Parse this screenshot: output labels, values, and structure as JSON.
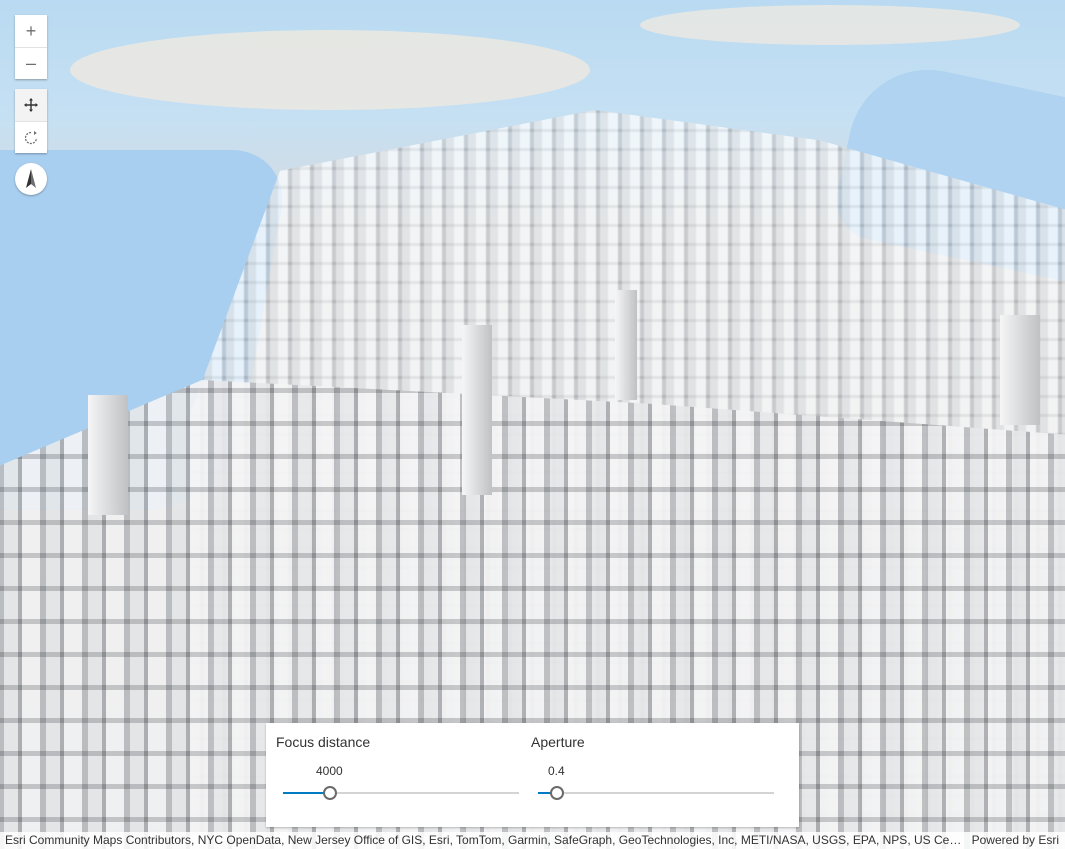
{
  "zoom": {
    "in_symbol": "+",
    "out_symbol": "–"
  },
  "navigation": {
    "pan_icon": "pan-arrows-icon",
    "rotate_icon": "rotate-icon"
  },
  "compass": {
    "icon": "compass-needle-icon"
  },
  "focus_distance": {
    "label": "Focus distance",
    "value": "4000",
    "fraction": 0.2
  },
  "aperture": {
    "label": "Aperture",
    "value": "0.4",
    "fraction": 0.08
  },
  "attribution": {
    "text": "Esri Community Maps Contributors, NYC OpenData, New Jersey Office of GIS, Esri, TomTom, Garmin, SafeGraph, GeoTechnologies, Inc, METI/NASA, USGS, EPA, NPS, US Census Bureau, USDA",
    "powered_by": "Powered by Esri"
  },
  "colors": {
    "accent": "#007ac2",
    "water": "#a9cff0",
    "buildings": "#e7e8ea"
  }
}
